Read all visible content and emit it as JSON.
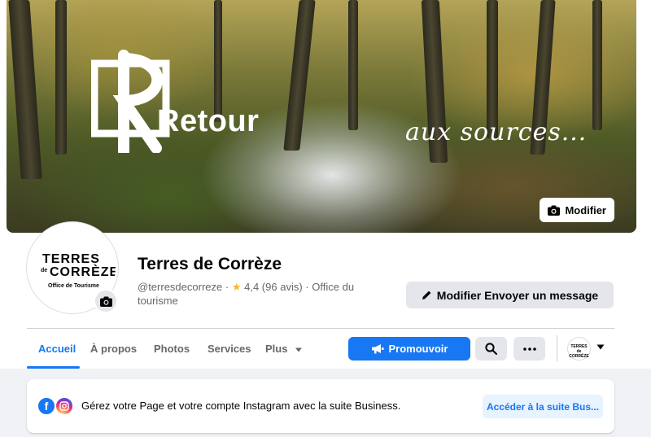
{
  "cover": {
    "title": "Retour",
    "subtitle": "aux sources...",
    "edit_label": "Modifier"
  },
  "avatar": {
    "line1": "TERRES",
    "de": "de",
    "line2": "CORRÈZE",
    "line3": "Office de Tourisme"
  },
  "profile": {
    "name": "Terres de Corrèze",
    "handle": "@terresdecorreze",
    "separator": "·",
    "rating": "4,4 (96 avis)",
    "category": "Office du tourisme",
    "message_label": "Modifier Envoyer un message"
  },
  "tabs": [
    {
      "label": "Accueil",
      "active": true
    },
    {
      "label": "À propos",
      "active": false
    },
    {
      "label": "Photos",
      "active": false
    },
    {
      "label": "Services",
      "active": false
    },
    {
      "label": "Plus",
      "active": false
    }
  ],
  "actions": {
    "promote_label": "Promouvoir",
    "mini_avatar_text": "TERRES de CORRÈZE"
  },
  "business_card": {
    "text": "Gérez votre Page et votre compte Instagram avec la suite Business.",
    "button_label": "Accéder à la suite Bus..."
  },
  "colors": {
    "accent": "#1877f2",
    "background": "#f0f2f5",
    "button_gray": "#e4e6eb"
  }
}
